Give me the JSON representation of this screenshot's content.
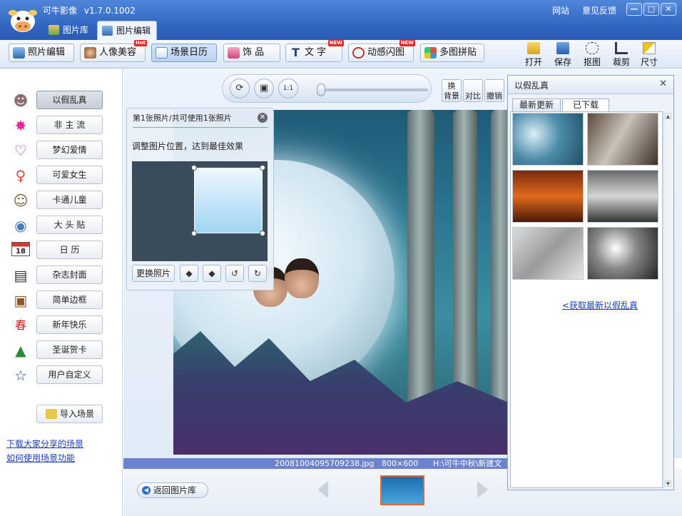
{
  "app": {
    "title": "可牛影像",
    "version": "v1.7.0.1002",
    "links": [
      "网站",
      "意见反馈"
    ],
    "window_buttons": [
      "—",
      "□",
      "✕"
    ]
  },
  "tabs": [
    {
      "label": "图片库",
      "active": false
    },
    {
      "label": "图片编辑",
      "active": true
    }
  ],
  "toolbar": {
    "buttons": [
      {
        "label": "照片编辑",
        "active": false
      },
      {
        "label": "人像美容",
        "active": false,
        "badge": "Hot"
      },
      {
        "label": "场景日历",
        "active": true
      },
      {
        "label": "饰 品",
        "active": false
      },
      {
        "label": "文 字",
        "active": false,
        "badge": "NEW"
      },
      {
        "label": "动感闪图",
        "active": false,
        "badge": "NEW"
      },
      {
        "label": "多图拼贴",
        "active": false
      }
    ],
    "right_tools": [
      "打开",
      "保存",
      "抠图",
      "裁剪",
      "尺寸"
    ]
  },
  "sidebar": {
    "items": [
      {
        "label": "以假乱真",
        "icon": "sheriff-icon",
        "active": true
      },
      {
        "label": "非 主 流",
        "icon": "star-burst-icon",
        "active": false
      },
      {
        "label": "梦幻爱情",
        "icon": "heart-icon",
        "active": false
      },
      {
        "label": "可爱女生",
        "icon": "female-icon",
        "active": false
      },
      {
        "label": "卡通儿童",
        "icon": "cartoon-icon",
        "active": false
      },
      {
        "label": "大 头 贴",
        "icon": "face-sticker-icon",
        "active": false
      },
      {
        "label": "日  历",
        "icon": "calendar-icon",
        "active": false
      },
      {
        "label": "杂志封面",
        "icon": "magazine-icon",
        "active": false
      },
      {
        "label": "简单边框",
        "icon": "frame-icon",
        "active": false
      },
      {
        "label": "新年快乐",
        "icon": "spring-icon",
        "active": false
      },
      {
        "label": "圣诞贺卡",
        "icon": "christmas-tree-icon",
        "active": false
      },
      {
        "label": "用户自定义",
        "icon": "star-outline-icon",
        "active": false
      }
    ],
    "import_label": "导入场景",
    "links": [
      "下载大家分享的场景",
      "如何使用场景功能"
    ]
  },
  "canvas_controls": {
    "buttons": [
      "rotate-icon",
      "fit-screen-icon",
      "actual-size-icon"
    ],
    "actual_size_label": "1:1",
    "zoom_fraction": 0.0,
    "side_buttons": [
      {
        "label": "换\n背景"
      },
      {
        "label": "对比"
      },
      {
        "label": "撤销"
      }
    ]
  },
  "photo_panel": {
    "title": "第1张照片/共可使用1张照片",
    "hint": "调整图片位置，达到最佳效果",
    "change_button": "更换照片"
  },
  "statusbar": {
    "filename": "20081004095709238.jpg",
    "dimensions": "800×600",
    "path": "H:\\可牛中秋\\新建文"
  },
  "bottom": {
    "back_button": "返回图片库"
  },
  "right_panel": {
    "title": "以假乱真",
    "tabs": [
      {
        "label": "最新更新",
        "active": false
      },
      {
        "label": "已下载",
        "active": true
      }
    ],
    "link": "<获取最新以假乱真"
  },
  "colors": {
    "title_bar": "#2f63c0",
    "status_bar": "#6d82cc",
    "link": "#1a3cb8",
    "film_border": "#e36b2d"
  }
}
